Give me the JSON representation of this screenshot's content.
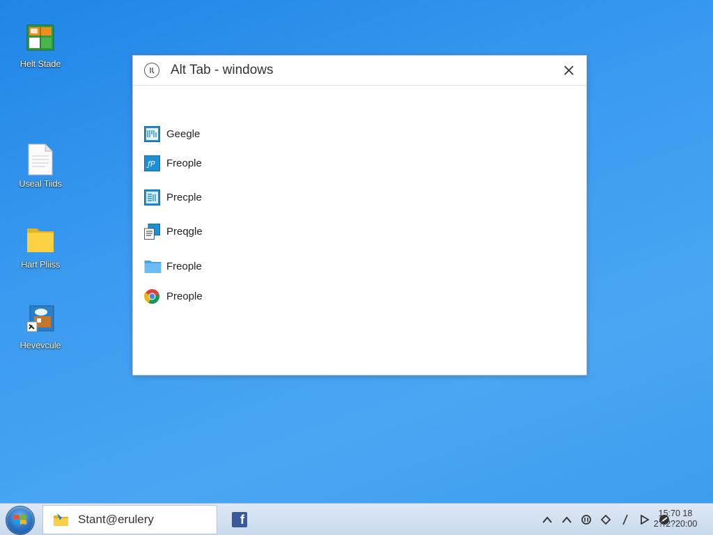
{
  "desktop": {
    "icons": [
      {
        "label": "Helt Stade",
        "icon": "spreadsheet-icon"
      },
      {
        "label": "Useal Tiids",
        "icon": "document-icon"
      },
      {
        "label": "Hart Pliiss",
        "icon": "folder-icon"
      },
      {
        "label": "Hevevcule",
        "icon": "network-picture-icon"
      }
    ]
  },
  "alt_tab": {
    "title": "Alt Tab - windows",
    "title_icon": "clock-icon",
    "close_icon": "close-icon",
    "windows": [
      {
        "name": "Geegle",
        "icon": "app-blue-grid-icon"
      },
      {
        "name": "Freople",
        "icon": "app-blue-script-icon"
      },
      {
        "name": "Precple",
        "icon": "app-blue-grid-icon"
      },
      {
        "name": "Preqgle",
        "icon": "app-doc-window-icon"
      },
      {
        "name": "Freople",
        "icon": "folder-icon"
      },
      {
        "name": "Preople",
        "icon": "chrome-icon"
      }
    ]
  },
  "taskbar": {
    "start_icon": "windows-logo-icon",
    "search_text": "Stant@erulery",
    "pinned": [
      {
        "icon": "facebook-icon",
        "letter": "f"
      }
    ],
    "tray": [
      {
        "icon": "chevron-up-icon"
      },
      {
        "icon": "chevron-up-icon"
      },
      {
        "icon": "network-icon"
      },
      {
        "icon": "diamond-icon"
      },
      {
        "icon": "slash-icon"
      },
      {
        "icon": "play-icon"
      },
      {
        "icon": "blocked-icon"
      }
    ],
    "clock_time": "15:70 18",
    "clock_date": "2?/2?20:00"
  },
  "colors": {
    "desktop": "#3b9bf0",
    "taskbar": "#d3e1f0",
    "window_bg": "#ffffff",
    "accent": "#1e8fd6"
  }
}
